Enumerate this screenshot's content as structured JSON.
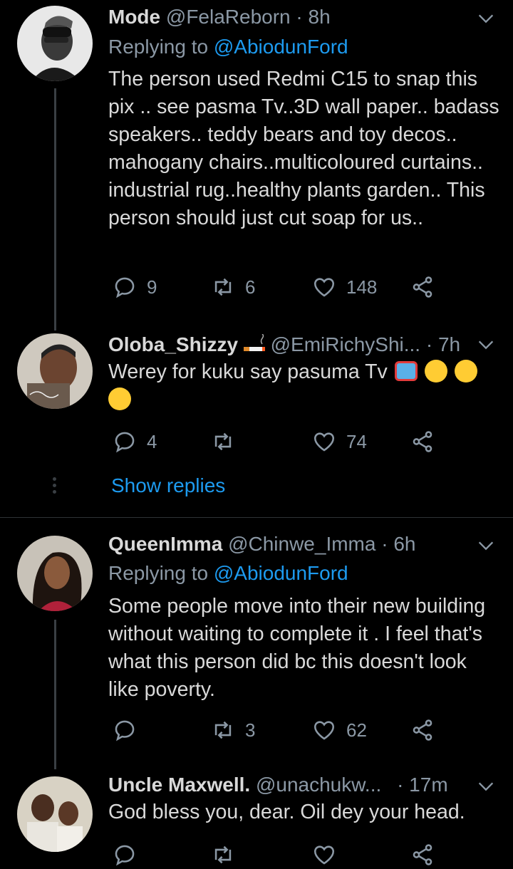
{
  "tweets": [
    {
      "name": "Mode",
      "handle": "@FelaReborn",
      "sep": "·",
      "time": "8h",
      "replying_prefix": "Replying to ",
      "replying_to": "@AbiodunFord",
      "text": "The person used Redmi C15 to snap this pix .. see pasma Tv..3D wall paper.. badass speakers.. teddy bears and toy decos.. mahogany chairs..multicoloured curtains.. industrial rug..healthy plants garden.. This person should just cut soap for us..",
      "reply_count": "9",
      "retweet_count": "6",
      "like_count": "148"
    },
    {
      "name": "Oloba_Shizzy",
      "handle": "@EmiRichyShi...",
      "sep": "·",
      "time": "7h",
      "text": "Werey for kuku say pasuma Tv",
      "emojis": [
        "tv-emoji",
        "tears-of-joy-emoji",
        "tears-of-joy-emoji",
        "tears-of-joy-emoji"
      ],
      "reply_count": "4",
      "retweet_count": "",
      "like_count": "74",
      "show_replies": "Show replies"
    },
    {
      "name": "QueenImma",
      "handle": "@Chinwe_Imma",
      "sep": "·",
      "time": "6h",
      "replying_prefix": "Replying to ",
      "replying_to": "@AbiodunFord",
      "text": "Some people move into their new building without waiting to complete it . I feel that's what this person did bc this doesn't look like poverty.",
      "reply_count": "",
      "retweet_count": "3",
      "like_count": "62"
    },
    {
      "name": "Uncle Maxwell.",
      "handle": "@unachukw...",
      "sep": "·",
      "time": "17m",
      "text": "God bless you, dear. Oil dey your head.",
      "reply_count": "",
      "retweet_count": "",
      "like_count": ""
    }
  ],
  "colors": {
    "background": "#000000",
    "text": "#d9d9d9",
    "secondary": "#8b98a5",
    "link": "#1d9bf0",
    "divider": "#2f3336"
  }
}
